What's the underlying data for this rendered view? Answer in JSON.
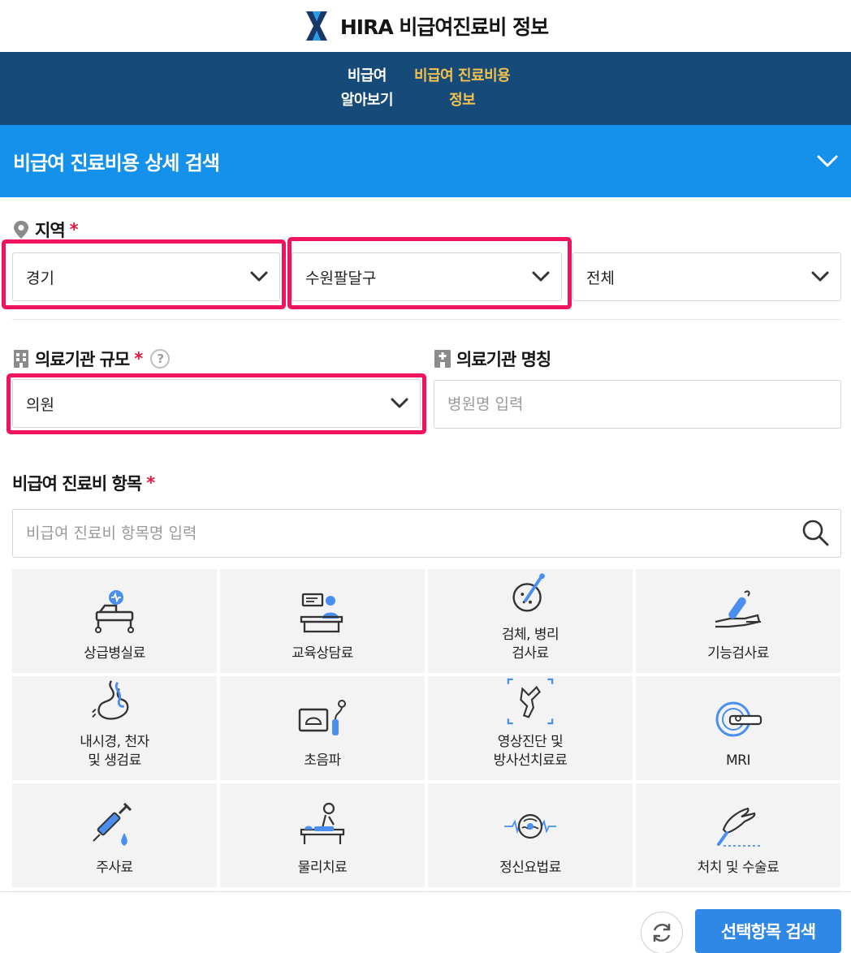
{
  "header": {
    "logo_icon": "hira-x-logo-icon",
    "title": "HIRA 비급여진료비 정보"
  },
  "nav": {
    "items": [
      {
        "line1": "비급여",
        "line2": "알아보기",
        "active": false
      },
      {
        "line1": "비급여 진료비용",
        "line2": "정보",
        "active": true
      }
    ]
  },
  "section": {
    "title": "비급여 진료비용 상세 검색",
    "toggle_icon": "chevron-down-icon"
  },
  "region": {
    "label": "지역",
    "required_mark": "*",
    "icon": "location-pin-icon",
    "selects": [
      {
        "value": "경기"
      },
      {
        "value": "수원팔달구"
      },
      {
        "value": "전체"
      }
    ]
  },
  "institution_size": {
    "label": "의료기관 규모",
    "required_mark": "*",
    "icon": "building-icon",
    "help_icon": "question-mark-icon",
    "help_text": "?",
    "select_value": "의원"
  },
  "institution_name": {
    "label": "의료기관 명칭",
    "icon": "hospital-icon",
    "placeholder": "병원명 입력"
  },
  "items": {
    "label": "비급여 진료비 항목",
    "required_mark": "*",
    "search_placeholder": "비급여 진료비 항목명 입력",
    "search_icon": "search-icon",
    "categories": [
      {
        "label": "상급병실료",
        "icon": "hospital-bed-icon"
      },
      {
        "label": "교육상담료",
        "icon": "counseling-desk-icon"
      },
      {
        "label": "검체, 병리\n검사료",
        "icon": "specimen-test-icon"
      },
      {
        "label": "기능검사료",
        "icon": "function-test-icon"
      },
      {
        "label": "내시경, 천자\n및 생검료",
        "icon": "endoscopy-icon"
      },
      {
        "label": "초음파",
        "icon": "ultrasound-icon"
      },
      {
        "label": "영상진단 및\n방사선치료료",
        "icon": "radiology-icon"
      },
      {
        "label": "MRI",
        "icon": "mri-icon"
      },
      {
        "label": "주사료",
        "icon": "syringe-icon"
      },
      {
        "label": "물리치료",
        "icon": "physical-therapy-icon"
      },
      {
        "label": "정신요법료",
        "icon": "brain-wave-icon"
      },
      {
        "label": "처치 및 수술료",
        "icon": "surgery-hand-icon"
      },
      {
        "label": "",
        "icon": ""
      },
      {
        "label": "",
        "icon": ""
      },
      {
        "label": "",
        "icon": ""
      },
      {
        "label": "",
        "icon": ""
      }
    ]
  },
  "footer": {
    "reset_icon": "refresh-icon",
    "search_button": "선택항목 검색"
  },
  "colors": {
    "nav_bg": "#164a78",
    "nav_active": "#f3c24f",
    "section_bg": "#1591ec",
    "required": "#e0183d",
    "highlight": "#f0145c",
    "primary_button": "#2f87e6",
    "icon_blue": "#4a8ff0"
  }
}
